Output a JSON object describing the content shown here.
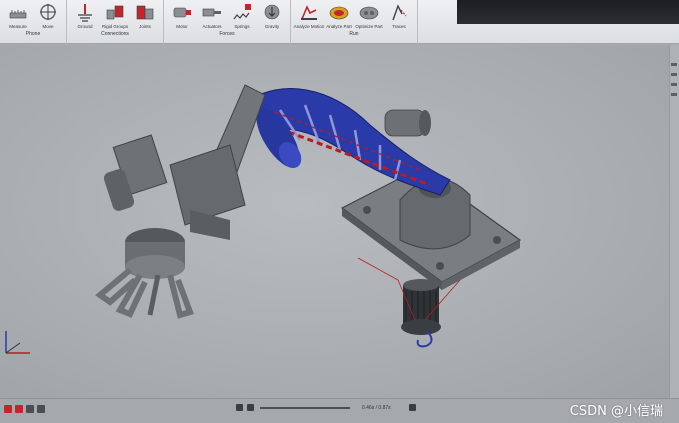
{
  "ribbon": {
    "groups": [
      {
        "label": "Phone",
        "tools": [
          {
            "label": "Measure",
            "icon": "measure-icon"
          },
          {
            "label": "Move",
            "icon": "move-icon"
          }
        ]
      },
      {
        "label": "Connections",
        "tools": [
          {
            "label": "Ground",
            "icon": "ground-icon"
          },
          {
            "label": "Rigid Groups",
            "icon": "rigid-groups-icon"
          },
          {
            "label": "Joints",
            "icon": "joints-icon"
          }
        ]
      },
      {
        "label": "Forces",
        "tools": [
          {
            "label": "Motor",
            "icon": "motor-icon"
          },
          {
            "label": "Actuators",
            "icon": "actuators-icon"
          },
          {
            "label": "Springs",
            "icon": "springs-icon"
          },
          {
            "label": "Gravity",
            "icon": "gravity-icon"
          }
        ]
      },
      {
        "label": "Run",
        "tools": [
          {
            "label": "Analyze Motion",
            "icon": "analyze-motion-icon"
          },
          {
            "label": "Analyze Part",
            "icon": "analyze-part-icon"
          },
          {
            "label": "Optimize Part",
            "icon": "optimize-part-icon"
          },
          {
            "label": "Traces",
            "icon": "traces-icon"
          }
        ]
      }
    ]
  },
  "timeline": {
    "time": "0.46s / 0.87s"
  },
  "watermark": "CSDN @小信瑞",
  "colors": {
    "ribbon_icon_red": "#c0262b",
    "part_blue": "#2a3aa8",
    "part_grey": "#6b6e72",
    "trace_red": "#b81c1c"
  }
}
